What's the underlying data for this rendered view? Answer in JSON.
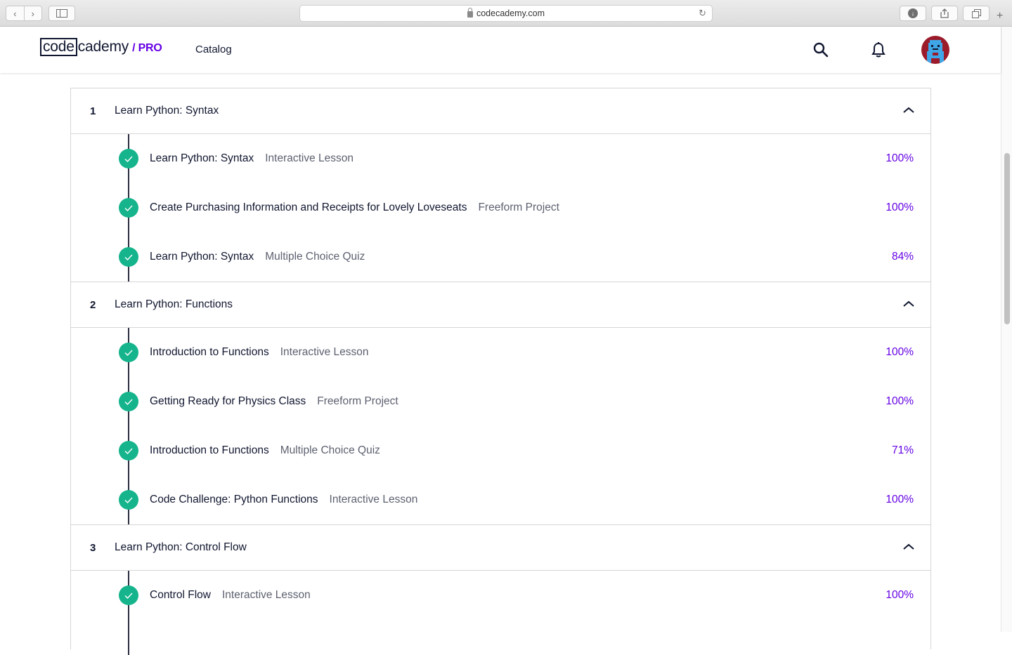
{
  "browser": {
    "url": "codecademy.com"
  },
  "header": {
    "logo_code": "code",
    "logo_rest": "cademy",
    "logo_pro": "/ PRO",
    "catalog": "Catalog"
  },
  "colors": {
    "accent": "#6400e4",
    "check": "#15b48c",
    "navy": "#10162f"
  },
  "modules": [
    {
      "num": "1",
      "title": "Learn Python: Syntax",
      "items": [
        {
          "title": "Learn Python: Syntax",
          "type": "Interactive Lesson",
          "pct": "100%"
        },
        {
          "title": "Create Purchasing Information and Receipts for Lovely Loveseats",
          "type": "Freeform Project",
          "pct": "100%"
        },
        {
          "title": "Learn Python: Syntax",
          "type": "Multiple Choice Quiz",
          "pct": "84%"
        }
      ]
    },
    {
      "num": "2",
      "title": "Learn Python: Functions",
      "items": [
        {
          "title": "Introduction to Functions",
          "type": "Interactive Lesson",
          "pct": "100%"
        },
        {
          "title": "Getting Ready for Physics Class",
          "type": "Freeform Project",
          "pct": "100%"
        },
        {
          "title": "Introduction to Functions",
          "type": "Multiple Choice Quiz",
          "pct": "71%"
        },
        {
          "title": "Code Challenge: Python Functions",
          "type": "Interactive Lesson",
          "pct": "100%"
        }
      ]
    },
    {
      "num": "3",
      "title": "Learn Python: Control Flow",
      "items": [
        {
          "title": "Control Flow",
          "type": "Interactive Lesson",
          "pct": "100%"
        }
      ]
    }
  ]
}
